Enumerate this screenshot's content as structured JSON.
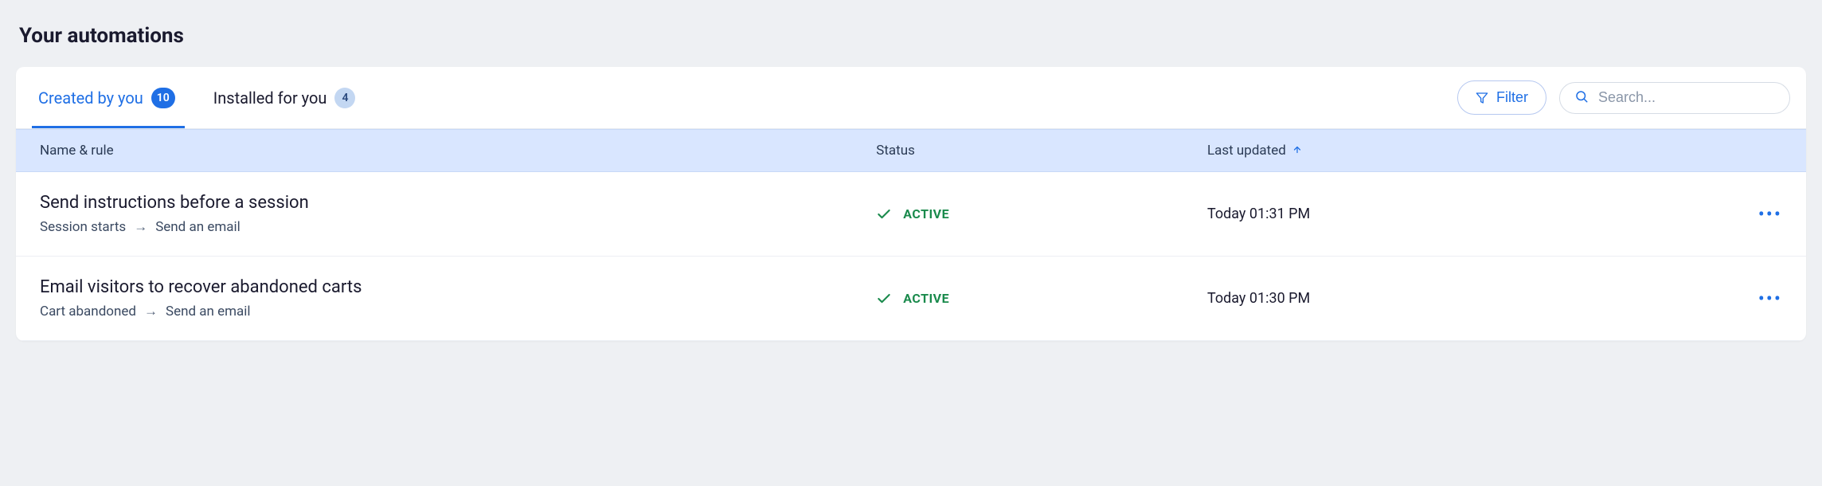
{
  "page_title": "Your automations",
  "tabs": [
    {
      "label": "Created by you",
      "count": "10"
    },
    {
      "label": "Installed for you",
      "count": "4"
    }
  ],
  "filter_label": "Filter",
  "search_placeholder": "Search...",
  "columns": {
    "name": "Name & rule",
    "status": "Status",
    "updated": "Last updated"
  },
  "rows": [
    {
      "title": "Send instructions before a session",
      "trigger": "Session starts",
      "action": "Send an email",
      "status": "ACTIVE",
      "updated": "Today 01:31 PM"
    },
    {
      "title": "Email visitors to recover abandoned carts",
      "trigger": "Cart abandoned",
      "action": "Send an email",
      "status": "ACTIVE",
      "updated": "Today 01:30 PM"
    }
  ]
}
